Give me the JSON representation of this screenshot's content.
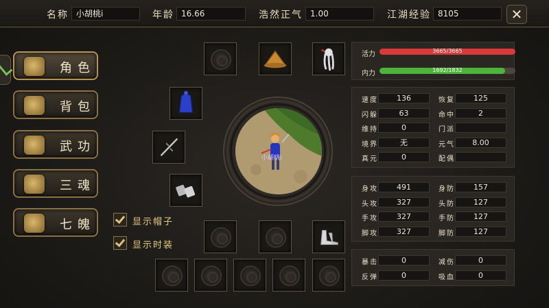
{
  "header": {
    "name_label": "名称",
    "name_value": "小胡桃i",
    "age_label": "年龄",
    "age_value": "16.66",
    "righteous_label": "浩然正气",
    "righteous_value": "1.00",
    "exp_label": "江湖经验",
    "exp_value": "8105"
  },
  "menu": [
    {
      "label": "角色",
      "icon": "character-icon",
      "active": true
    },
    {
      "label": "背包",
      "icon": "bag-icon",
      "active": false
    },
    {
      "label": "武功",
      "icon": "scroll-icon",
      "active": false
    },
    {
      "label": "三魂",
      "icon": "soul-icon",
      "active": false
    },
    {
      "label": "七魄",
      "icon": "spirit-icon",
      "active": false
    }
  ],
  "options": {
    "show_hat": "显示帽子",
    "show_fashion": "显示时装",
    "show_hat_checked": true,
    "show_fashion_checked": true
  },
  "character": {
    "name": "小胡桃i"
  },
  "bars": {
    "hp_label": "活力",
    "hp_text": "3665/3665",
    "hp_fraction": 1.0,
    "mp_label": "内力",
    "mp_text": "1692/1832",
    "mp_fraction": 0.9236,
    "hp_color": "#d83a3a",
    "mp_color": "#4cb43a"
  },
  "attributes": [
    {
      "l1": "速度",
      "v1": "136",
      "l2": "恢复",
      "v2": "125"
    },
    {
      "l1": "闪躲",
      "v1": "63",
      "l2": "命中",
      "v2": "2"
    },
    {
      "l1": "维持",
      "v1": "0",
      "l2": "门派",
      "v2": ""
    },
    {
      "l1": "境界",
      "v1": "无",
      "l2": "元气",
      "v2": "8.00"
    },
    {
      "l1": "真元",
      "v1": "0",
      "l2": "配偶",
      "v2": ""
    }
  ],
  "combat": [
    {
      "l1": "身攻",
      "v1": "491",
      "l2": "身防",
      "v2": "157"
    },
    {
      "l1": "头攻",
      "v1": "327",
      "l2": "头防",
      "v2": "127"
    },
    {
      "l1": "手攻",
      "v1": "327",
      "l2": "手防",
      "v2": "127"
    },
    {
      "l1": "脚攻",
      "v1": "327",
      "l2": "脚防",
      "v2": "127"
    }
  ],
  "special": [
    {
      "l1": "暴击",
      "v1": "0",
      "l2": "减伤",
      "v2": "0"
    },
    {
      "l1": "反弹",
      "v1": "0",
      "l2": "吸血",
      "v2": "0"
    }
  ],
  "close_icon": "close-icon"
}
